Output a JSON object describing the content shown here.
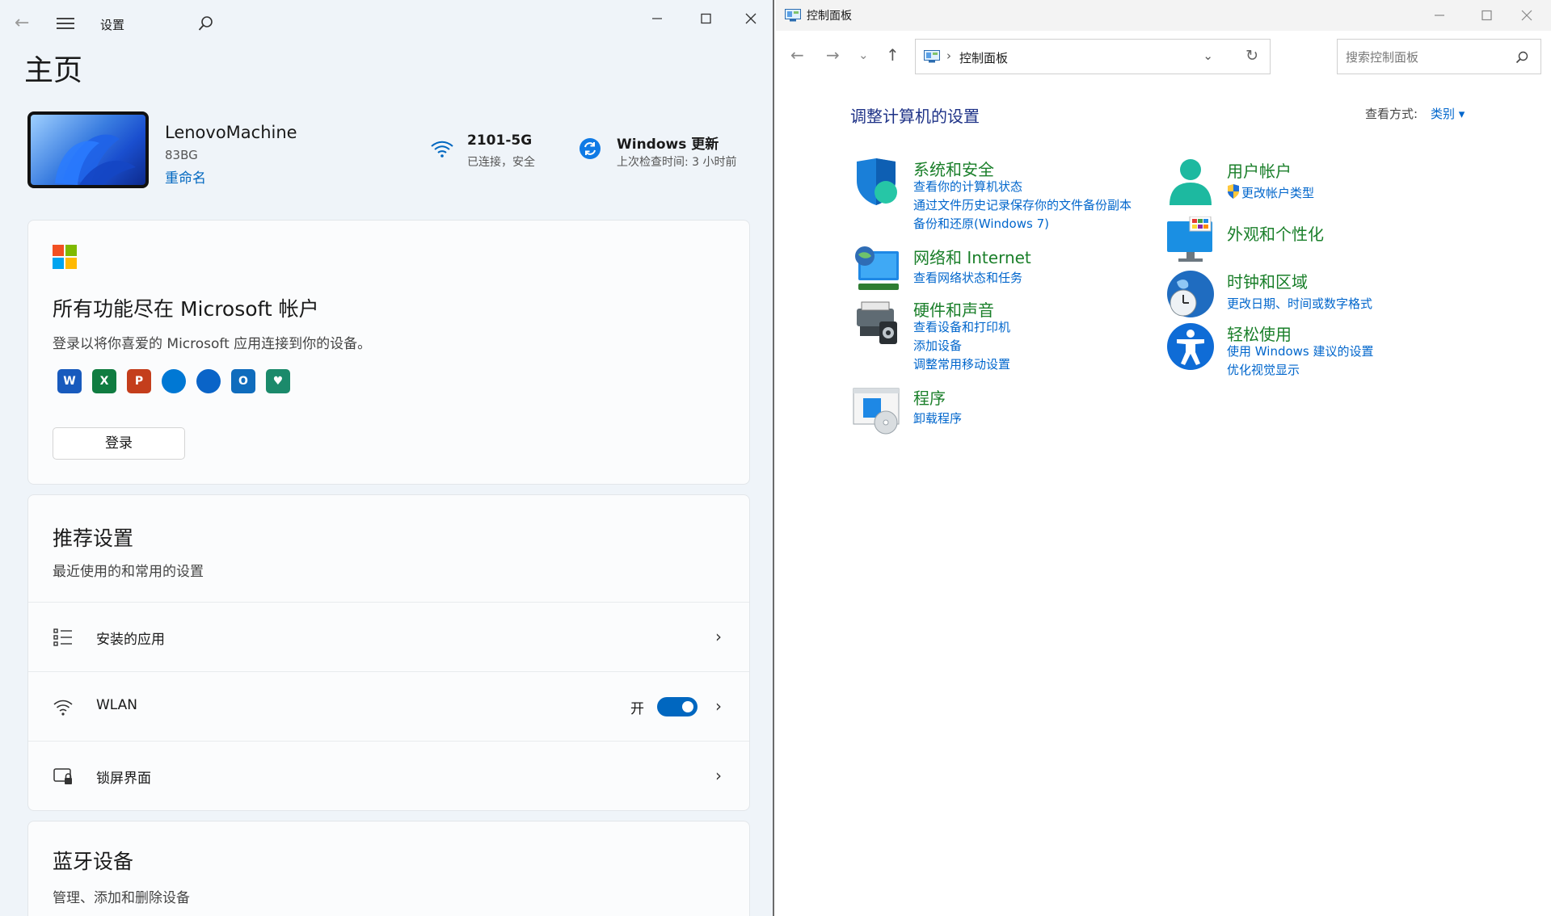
{
  "settings": {
    "window_title": "设置",
    "page_title": "主页",
    "device": {
      "name": "LenovoMachine",
      "model": "83BG",
      "rename": "重命名"
    },
    "wifi": {
      "name": "2101-5G",
      "status": "已连接，安全"
    },
    "update": {
      "title": "Windows 更新",
      "status": "上次检查时间: 3 小时前"
    },
    "ms_card": {
      "title": "所有功能尽在 Microsoft 帐户",
      "description": "登录以将你喜爱的 Microsoft 应用连接到你的设备。",
      "apps": [
        {
          "icon": "word-icon",
          "color": "#185abd",
          "glyph": "W"
        },
        {
          "icon": "excel-icon",
          "color": "#107c41",
          "glyph": "X"
        },
        {
          "icon": "powerpoint-icon",
          "color": "#c43e1c",
          "glyph": "P"
        },
        {
          "icon": "defender-icon",
          "color": "#0078d4",
          "glyph": ""
        },
        {
          "icon": "onedrive-icon",
          "color": "#0a64c8",
          "glyph": ""
        },
        {
          "icon": "outlook-icon",
          "color": "#0f6cbd",
          "glyph": "O"
        },
        {
          "icon": "family-icon",
          "color": "#1b8a6b",
          "glyph": "♥"
        }
      ],
      "login_label": "登录"
    },
    "recommended": {
      "title": "推荐设置",
      "subtitle": "最近使用的和常用的设置",
      "rows": [
        {
          "label": "安装的应用",
          "icon": "apps-list-icon"
        },
        {
          "label": "WLAN",
          "icon": "wifi-icon",
          "toggle_text": "开",
          "toggle_on": true
        },
        {
          "label": "锁屏界面",
          "icon": "lock-screen-icon"
        }
      ]
    },
    "bluetooth": {
      "title": "蓝牙设备",
      "subtitle": "管理、添加和删除设备"
    }
  },
  "control_panel": {
    "window_title": "控制面板",
    "address": "控制面板",
    "search_placeholder": "搜索控制面板",
    "heading": "调整计算机的设置",
    "view_by_label": "查看方式:",
    "view_by_value": "类别 ▾",
    "left_categories": [
      {
        "title": "系统和安全",
        "icon": "system-security-icon",
        "links": [
          "查看你的计算机状态",
          "通过文件历史记录保存你的文件备份副本",
          "备份和还原(Windows 7)"
        ]
      },
      {
        "title": "网络和 Internet",
        "icon": "network-icon",
        "links": [
          "查看网络状态和任务"
        ]
      },
      {
        "title": "硬件和声音",
        "icon": "hardware-sound-icon",
        "links": [
          "查看设备和打印机",
          "添加设备",
          "调整常用移动设置"
        ]
      },
      {
        "title": "程序",
        "icon": "programs-icon",
        "links": [
          "卸载程序"
        ]
      }
    ],
    "right_categories": [
      {
        "title": "用户帐户",
        "icon": "user-accounts-icon",
        "links": [
          "更改帐户类型"
        ]
      },
      {
        "title": "外观和个性化",
        "icon": "appearance-icon",
        "links": []
      },
      {
        "title": "时钟和区域",
        "icon": "clock-region-icon",
        "links": [
          "更改日期、时间或数字格式"
        ]
      },
      {
        "title": "轻松使用",
        "icon": "ease-of-access-icon",
        "links": [
          "使用 Windows 建议的设置",
          "优化视觉显示"
        ]
      }
    ]
  }
}
